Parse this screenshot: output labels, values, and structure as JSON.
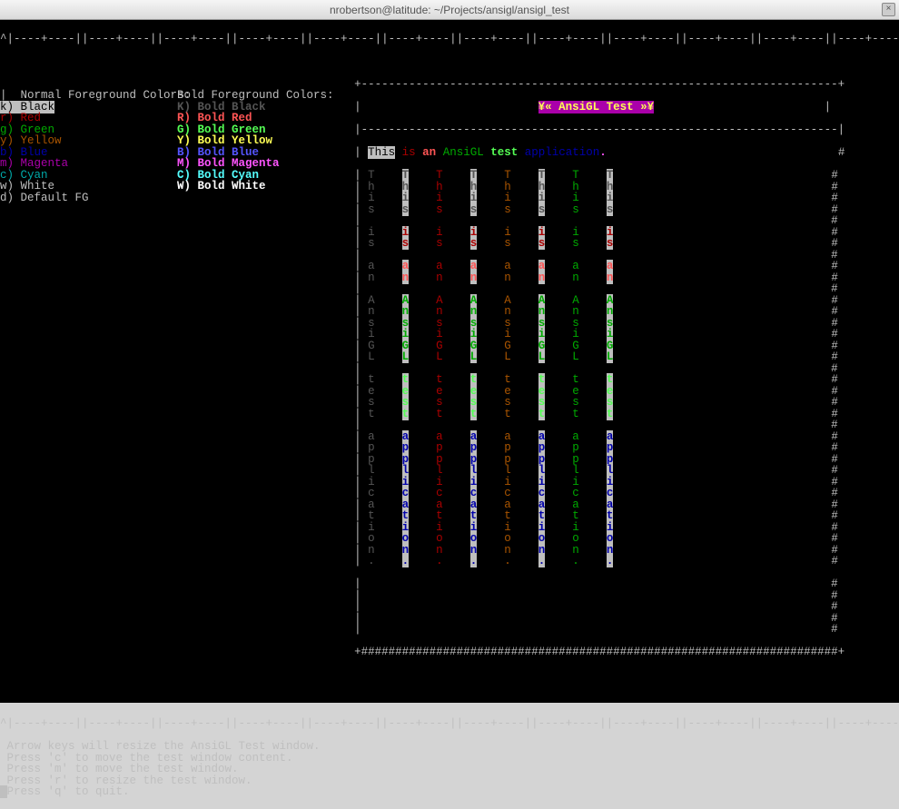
{
  "window": {
    "title": "nrobertson@latitude: ~/Projects/ansigl/ansigl_test"
  },
  "ruler": "^|----+----||----+----||----+----||----+----||----+----||----+----||----+----||----+----||----+----||----+----||----+----||----+----||----+----||--",
  "headers": {
    "normal": "Normal Foreground Colors:",
    "bold": "Bold Foreground Colors:"
  },
  "normal_colors": [
    {
      "key": "k",
      "label": "Black",
      "cls": "fg-w",
      "bg": "bg-w",
      "txtcls": "fg-k"
    },
    {
      "key": "r",
      "label": "Red",
      "cls": "fg-r"
    },
    {
      "key": "g",
      "label": "Green",
      "cls": "fg-g"
    },
    {
      "key": "y",
      "label": "Yellow",
      "cls": "fg-y"
    },
    {
      "key": "b",
      "label": "Blue",
      "cls": "fg-b"
    },
    {
      "key": "m",
      "label": "Magenta",
      "cls": "fg-m"
    },
    {
      "key": "c",
      "label": "Cyan",
      "cls": "fg-c"
    },
    {
      "key": "w",
      "label": "White",
      "cls": "fg-w"
    },
    {
      "key": "d",
      "label": "Default FG",
      "cls": "fg-d"
    }
  ],
  "bold_colors": [
    {
      "key": "K",
      "label": "Bold Black",
      "cls": "fg-K"
    },
    {
      "key": "R",
      "label": "Bold Red",
      "cls": "fg-R"
    },
    {
      "key": "G",
      "label": "Bold Green",
      "cls": "fg-G"
    },
    {
      "key": "Y",
      "label": "Bold Yellow",
      "cls": "fg-Y"
    },
    {
      "key": "B",
      "label": "Bold Blue",
      "cls": "fg-B"
    },
    {
      "key": "M",
      "label": "Bold Magenta",
      "cls": "fg-M"
    },
    {
      "key": "C",
      "label": "Bold Cyan",
      "cls": "fg-C"
    },
    {
      "key": "W",
      "label": "Bold White",
      "cls": "fg-W"
    }
  ],
  "test_window": {
    "title": "¥« AnsiGL Test »¥",
    "sentence_words": [
      {
        "word": "This",
        "cls": "fg-k",
        "bg": "bg-w"
      },
      {
        "word": "is",
        "cls": "fg-r"
      },
      {
        "word": "an",
        "cls": "fg-R",
        "bd": true
      },
      {
        "word": "AnsiGL",
        "cls": "fg-g"
      },
      {
        "word": "test",
        "cls": "fg-G",
        "bd": true
      },
      {
        "word": "application",
        "cls": "fg-b"
      },
      {
        "word": ".",
        "cls": "fg-M",
        "bd": true
      }
    ],
    "vertical_words": [
      "This",
      "is",
      "an",
      "AnsiGL",
      "test",
      "application."
    ],
    "vertical_word_classes": [
      "fg-K",
      "fg-r",
      "fg-R",
      "fg-g",
      "fg-G",
      "fg-b"
    ],
    "column_classes": [
      "fg-K",
      "fg-R",
      "fg-r",
      "fg-Y",
      "fg-y",
      "fg-G",
      "fg-g",
      "fg-W"
    ],
    "column_bg": [
      "",
      "bg-w",
      "",
      "bg-w",
      "",
      "bg-w",
      "",
      "bg-w"
    ]
  },
  "help": [
    "Arrow keys will resize the AnsiGL Test window.",
    "Press 'c' to move the test window content.",
    "Press 'm' to move the test window.",
    "Press 'r' to resize the test window.",
    "Press 'q' to quit."
  ]
}
